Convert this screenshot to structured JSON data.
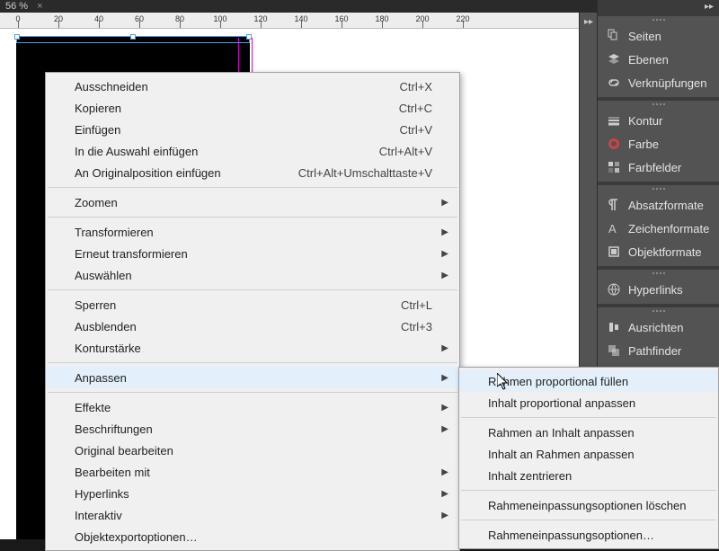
{
  "tab": {
    "zoom": "56 %",
    "close": "×"
  },
  "ruler": {
    "marks": [
      0,
      20,
      40,
      60,
      80,
      100,
      120,
      140,
      160,
      180,
      200,
      220
    ]
  },
  "panels": [
    {
      "group": [
        {
          "icon": "pages",
          "label": "Seiten"
        },
        {
          "icon": "layers",
          "label": "Ebenen"
        },
        {
          "icon": "links",
          "label": "Verknüpfungen"
        }
      ]
    },
    {
      "group": [
        {
          "icon": "stroke",
          "label": "Kontur"
        },
        {
          "icon": "color",
          "label": "Farbe"
        },
        {
          "icon": "swatches",
          "label": "Farbfelder"
        }
      ]
    },
    {
      "group": [
        {
          "icon": "para",
          "label": "Absatzformate"
        },
        {
          "icon": "char",
          "label": "Zeichenformate"
        },
        {
          "icon": "obj",
          "label": "Objektformate"
        }
      ]
    },
    {
      "group": [
        {
          "icon": "hyper",
          "label": "Hyperlinks"
        }
      ]
    },
    {
      "group": [
        {
          "icon": "align",
          "label": "Ausrichten"
        },
        {
          "icon": "path",
          "label": "Pathfinder"
        }
      ]
    }
  ],
  "ctx": {
    "items": [
      {
        "label": "Ausschneiden",
        "sc": "Ctrl+X"
      },
      {
        "label": "Kopieren",
        "sc": "Ctrl+C"
      },
      {
        "label": "Einfügen",
        "sc": "Ctrl+V"
      },
      {
        "label": "In die Auswahl einfügen",
        "sc": "Ctrl+Alt+V"
      },
      {
        "label": "An Originalposition einfügen",
        "sc": "Ctrl+Alt+Umschalttaste+V"
      },
      {
        "sep": true
      },
      {
        "label": "Zoomen",
        "sub": true
      },
      {
        "sep": true
      },
      {
        "label": "Transformieren",
        "sub": true
      },
      {
        "label": "Erneut transformieren",
        "sub": true
      },
      {
        "label": "Auswählen",
        "sub": true
      },
      {
        "sep": true
      },
      {
        "label": "Sperren",
        "sc": "Ctrl+L"
      },
      {
        "label": "Ausblenden",
        "sc": "Ctrl+3"
      },
      {
        "label": "Konturstärke",
        "sub": true
      },
      {
        "sep": true
      },
      {
        "label": "Anpassen",
        "sub": true,
        "hover": true
      },
      {
        "sep": true
      },
      {
        "label": "Effekte",
        "sub": true
      },
      {
        "label": "Beschriftungen",
        "sub": true
      },
      {
        "label": "Original bearbeiten"
      },
      {
        "label": "Bearbeiten mit",
        "sub": true
      },
      {
        "label": "Hyperlinks",
        "sub": true
      },
      {
        "label": "Interaktiv",
        "sub": true
      },
      {
        "label": "Objektexportoptionen…"
      }
    ]
  },
  "flyout": {
    "items": [
      {
        "label": "Rahmen proportional füllen",
        "hover": true
      },
      {
        "label": "Inhalt proportional anpassen"
      },
      {
        "sep": true
      },
      {
        "label": "Rahmen an Inhalt anpassen"
      },
      {
        "label": "Inhalt an Rahmen anpassen"
      },
      {
        "label": "Inhalt zentrieren"
      },
      {
        "sep": true
      },
      {
        "label": "Rahmeneinpassungsoptionen löschen"
      },
      {
        "sep": true
      },
      {
        "label": "Rahmeneinpassungsoptionen…"
      }
    ]
  }
}
